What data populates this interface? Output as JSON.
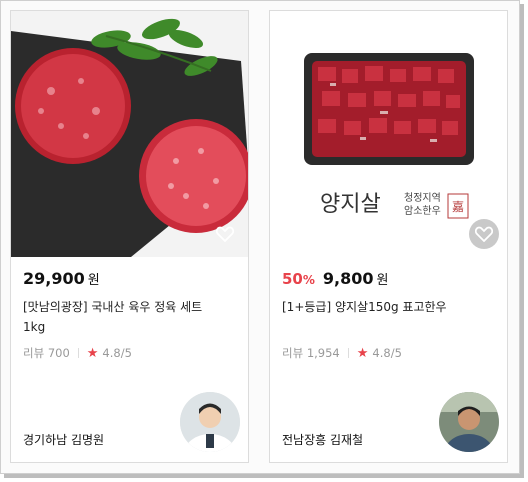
{
  "products": [
    {
      "price": "29,900",
      "currency": "원",
      "title": "[맛남의광장] 국내산 육우 정육 세트 1kg",
      "review_label": "리뷰 700",
      "rating": "4.8/5",
      "seller": "경기하남 김명원",
      "image_icon": "ground-beef-photo",
      "colors": {
        "meat": "#c8283a",
        "board": "#2a2a2a"
      }
    },
    {
      "discount": "50",
      "discount_unit": "%",
      "price": "9,800",
      "currency": "원",
      "title": "[1+등급] 양지살150g 표고한우",
      "review_label": "리뷰 1,954",
      "rating": "4.8/5",
      "seller": "전남장흥 김재철",
      "image_brand_text": "양지살",
      "image_brand_sub1": "청정지역",
      "image_brand_sub2": "암소한우",
      "image_seal_text": "嘉",
      "colors": {
        "discount": "#e8434b",
        "tray": "#2b2b2b"
      }
    }
  ]
}
